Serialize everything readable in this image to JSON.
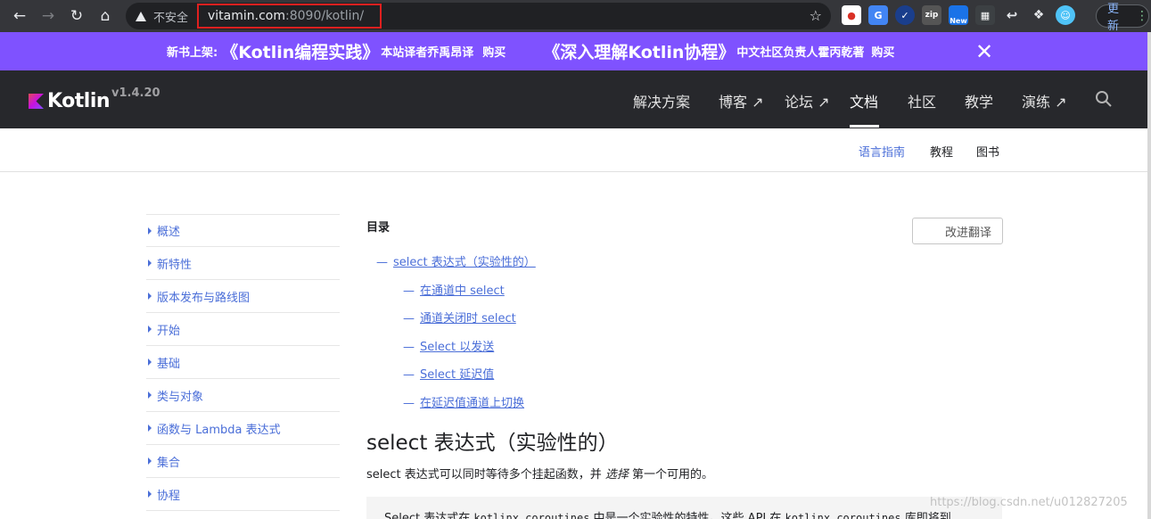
{
  "browser": {
    "back_icon": "arrow-left",
    "forward_icon": "arrow-right",
    "reload_icon": "reload",
    "home_icon": "home",
    "security_label": "不安全",
    "url_host": "vitamin.com",
    "url_rest": ":8090/kotlin/",
    "update_label": "更新",
    "extensions": [
      "ext-1",
      "ext-translate",
      "ext-check",
      "ext-zip",
      "ext-new",
      "ext-grid",
      "ext-back",
      "ext-puzzle",
      "ext-avatar"
    ],
    "new_badge": "New"
  },
  "promo": {
    "label1": "新书上架:",
    "book1": "《Kotlin编程实践》",
    "desc1": "本站译者乔禹昂译",
    "buy1": "购买",
    "book2": "《深入理解Kotlin协程》",
    "desc2": "中文社区负责人霍丙乾著",
    "buy2": "购买"
  },
  "header": {
    "logo": "Kotlin",
    "version": "v1.4.20",
    "nav": [
      "解决方案",
      "博客 ↗",
      "论坛 ↗",
      "文档",
      "社区",
      "教学",
      "演练 ↗"
    ]
  },
  "subnav": [
    "语言指南",
    "教程",
    "图书"
  ],
  "sidebar": [
    "概述",
    "新特性",
    "版本发布与路线图",
    "开始",
    "基础",
    "类与对象",
    "函数与 Lambda 表达式",
    "集合",
    "协程"
  ],
  "toc": {
    "title": "目录",
    "improve": "改进翻译",
    "items": [
      "select 表达式（实验性的）",
      "在通道中 select",
      "通道关闭时 select",
      "Select 以发送",
      "Select 延迟值",
      "在延迟值通道上切换"
    ]
  },
  "content": {
    "heading": "select 表达式（实验性的）",
    "para_before": "select 表达式可以同时等待多个挂起函数，并 ",
    "para_em": "选择",
    "para_after": " 第一个可用的。",
    "note_a": "Select 表达式在 ",
    "note_code1": "kotlinx.coroutines",
    "note_b": " 中是一个实验性的特性。这些 API 在 ",
    "note_code2": "kotlinx.coroutines",
    "note_c": " 库即将到",
    "watermark": "https://blog.csdn.net/u012827205"
  }
}
